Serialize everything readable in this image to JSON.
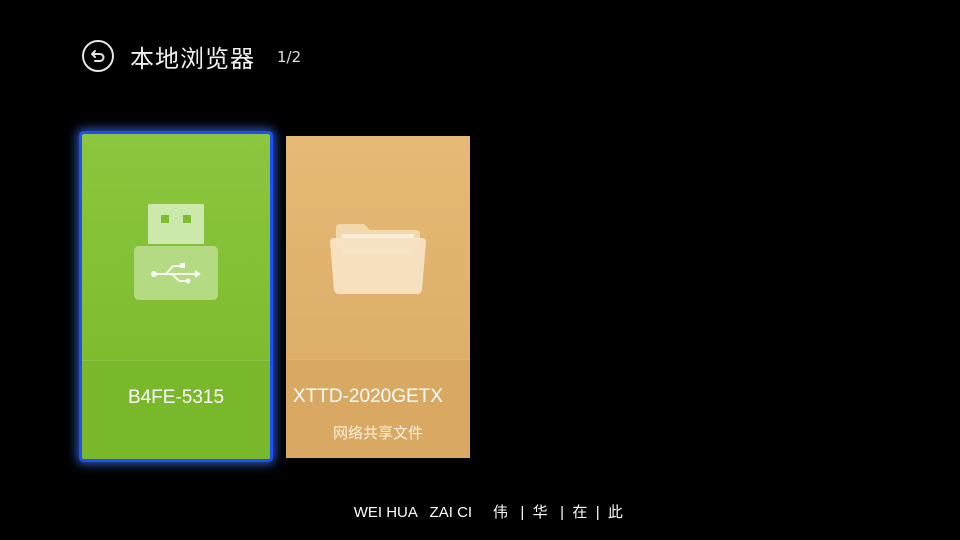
{
  "header": {
    "back_icon": "back-arrow-icon",
    "title": "本地浏览器",
    "page_indicator": "1/2"
  },
  "tiles": [
    {
      "name": "B4FE-5315",
      "subtitle": "",
      "icon": "usb-drive-icon",
      "color": "#8cc63f",
      "selected": true
    },
    {
      "name": "XTTD-2020GETX",
      "subtitle": "网络共享文件",
      "icon": "folder-icon",
      "color": "#e6ba76",
      "selected": false
    }
  ],
  "ticker": {
    "text": "WEI HUA   ZAI CI     伟   |  华   |  在  |  此"
  },
  "colors": {
    "background": "#000000",
    "focus_border": "#1e4fff"
  }
}
